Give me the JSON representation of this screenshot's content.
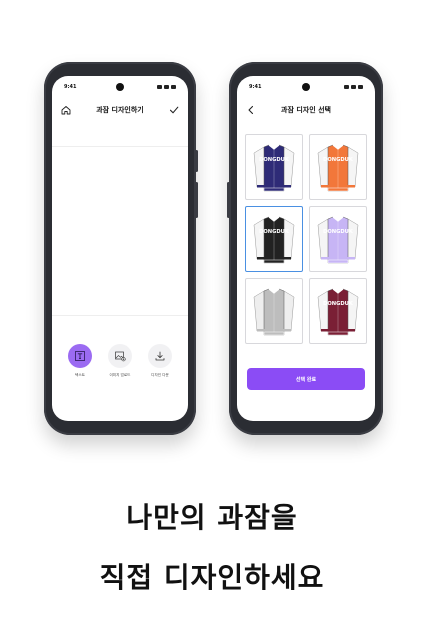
{
  "colors": {
    "accent": "#8b4cf5",
    "tool_active": "#9b6bf2",
    "selection": "#4a90e2"
  },
  "phone_left": {
    "status_time": "9:41",
    "title": "과잠 디자인하기",
    "home_icon": "home-icon",
    "done_icon": "check-icon",
    "tools": [
      {
        "label": "텍스트",
        "icon": "text-box-icon",
        "active": true
      },
      {
        "label": "이미지 업로드",
        "icon": "image-upload-icon",
        "active": false
      },
      {
        "label": "디자인 다운",
        "icon": "download-icon",
        "active": false
      }
    ]
  },
  "phone_right": {
    "status_time": "9:41",
    "title": "과잠 디자인 선택",
    "back_icon": "back-arrow-icon",
    "jackets": [
      {
        "print": "DONGDUK",
        "body": "#2e2b77",
        "sleeve": "#f5f5f5",
        "selected": false
      },
      {
        "print": "DONGDUK",
        "body": "#f2773a",
        "sleeve": "#f5f5f5",
        "selected": false
      },
      {
        "print": "DONGDUK",
        "body": "#222222",
        "sleeve": "#f5f5f5",
        "selected": true
      },
      {
        "print": "DONGDUK",
        "body": "#c7b5f5",
        "sleeve": "#f5f5f5",
        "selected": false
      },
      {
        "print": "",
        "body": "#bdbdbd",
        "sleeve": "#eeeeee",
        "selected": false
      },
      {
        "print": "DONGDUK",
        "body": "#7a1f35",
        "sleeve": "#f5f5f5",
        "selected": false
      }
    ],
    "confirm_label": "선택 완료"
  },
  "headline": {
    "line1": "나만의 과잠을",
    "line2": "직접 디자인하세요"
  }
}
